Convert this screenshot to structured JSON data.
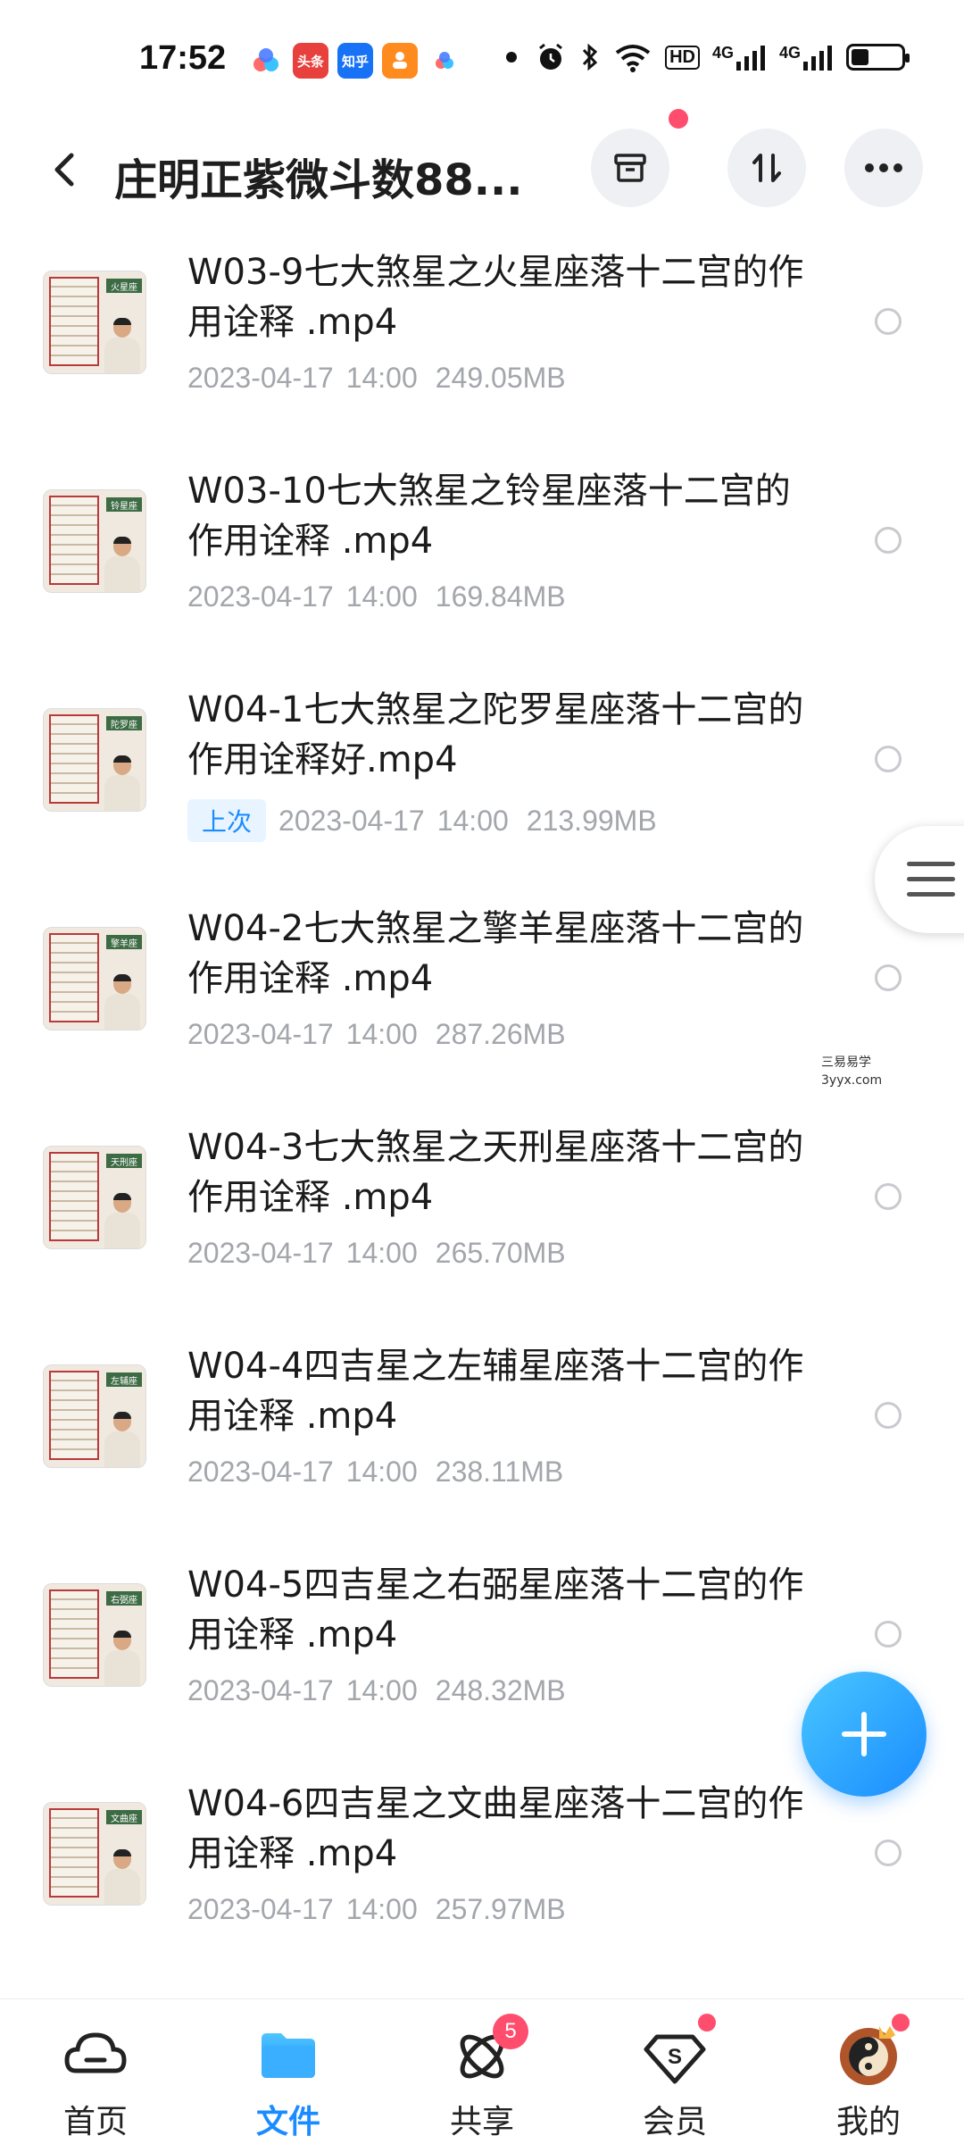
{
  "status_bar": {
    "time": "17:52",
    "apps": [
      {
        "name": "baidu-netdisk-icon",
        "label": "",
        "color": "#4a8cff"
      },
      {
        "name": "toutiao-icon",
        "label": "头条",
        "color": "#e8403c"
      },
      {
        "name": "zhihu-icon",
        "label": "知乎",
        "color": "#1772f6"
      },
      {
        "name": "app-orange-icon",
        "label": "",
        "color": "#ff8a1e"
      },
      {
        "name": "baidu-netdisk-small-icon",
        "label": "",
        "color": "#4aa8ff"
      }
    ],
    "network_labels": [
      "HD",
      "4G",
      "4G"
    ],
    "battery_level": 0.35
  },
  "header": {
    "back_icon": "chevron-left-icon",
    "title": "庄明正紫微斗数88..."
  },
  "files": [
    {
      "name": "W03-9七大煞星之火星座落十二宫的作用诠释 .mp4",
      "thumb_label": "火星座",
      "date": "2023-04-17",
      "time": "14:00",
      "size": "249.05MB",
      "tag": ""
    },
    {
      "name": "W03-10七大煞星之铃星座落十二宫的作用诠释 .mp4",
      "thumb_label": "铃星座",
      "date": "2023-04-17",
      "time": "14:00",
      "size": "169.84MB",
      "tag": ""
    },
    {
      "name": "W04-1七大煞星之陀罗星座落十二宫的作用诠释好.mp4",
      "thumb_label": "陀罗座",
      "date": "2023-04-17",
      "time": "14:00",
      "size": "213.99MB",
      "tag": "上次"
    },
    {
      "name": "W04-2七大煞星之擎羊星座落十二宫的作用诠释 .mp4",
      "thumb_label": "擎羊座",
      "date": "2023-04-17",
      "time": "14:00",
      "size": "287.26MB",
      "tag": ""
    },
    {
      "name": "W04-3七大煞星之天刑星座落十二宫的作用诠释 .mp4",
      "thumb_label": "天刑座",
      "date": "2023-04-17",
      "time": "14:00",
      "size": "265.70MB",
      "tag": ""
    },
    {
      "name": "W04-4四吉星之左辅星座落十二宫的作用诠释 .mp4",
      "thumb_label": "左辅座",
      "date": "2023-04-17",
      "time": "14:00",
      "size": "238.11MB",
      "tag": ""
    },
    {
      "name": "W04-5四吉星之右弼星座落十二宫的作用诠释 .mp4",
      "thumb_label": "右弼座",
      "date": "2023-04-17",
      "time": "14:00",
      "size": "248.32MB",
      "tag": ""
    },
    {
      "name": "W04-6四吉星之文曲星座落十二宫的作用诠释 .mp4",
      "thumb_label": "文曲座",
      "date": "2023-04-17",
      "time": "14:00",
      "size": "257.97MB",
      "tag": ""
    }
  ],
  "watermark": {
    "line1": "三易易学",
    "line2": "3yyx.com"
  },
  "bottom_nav": {
    "home": "首页",
    "files": "文件",
    "share": "共享",
    "share_badge": "5",
    "vip": "会员",
    "mine": "我的"
  },
  "colors": {
    "accent": "#1a8cff",
    "badge": "#ff4d6d",
    "meta_text": "#a3a6ab"
  }
}
